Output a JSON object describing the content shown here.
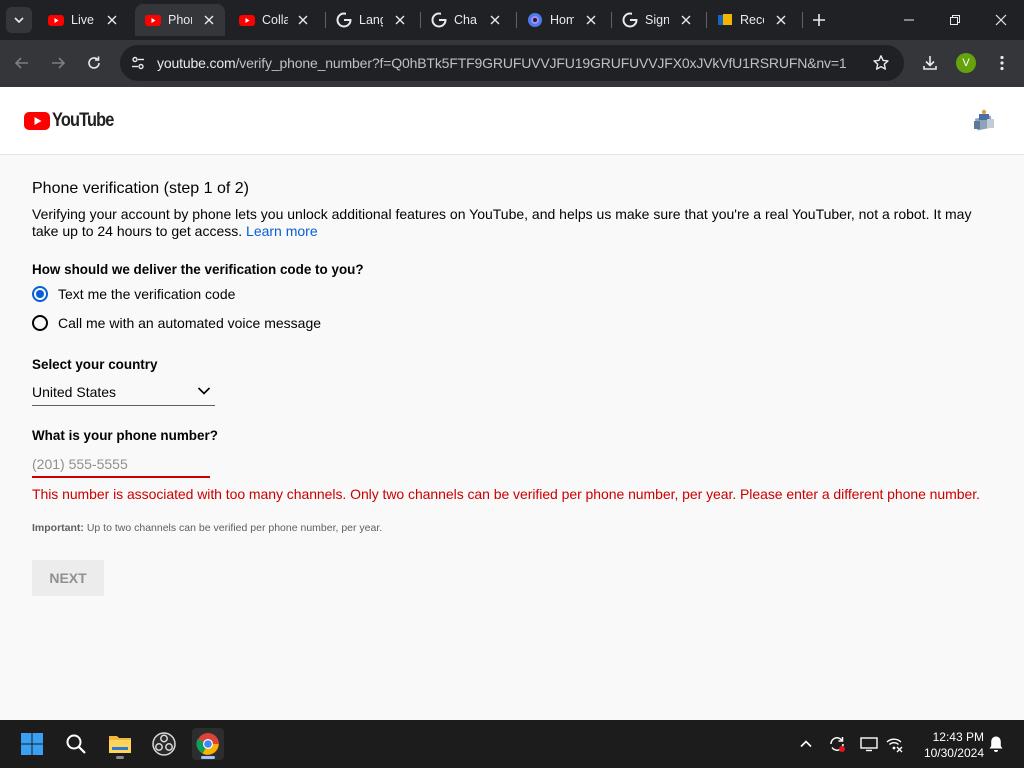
{
  "browser": {
    "tabs": [
      {
        "title": "Live",
        "favicon": "youtube-icon",
        "active": false
      },
      {
        "title": "Phone verification",
        "favicon": "youtube-icon",
        "active": true
      },
      {
        "title": "Collab",
        "favicon": "youtube-icon",
        "active": false
      },
      {
        "title": "Language",
        "favicon": "google-icon",
        "active": false
      },
      {
        "title": "Change",
        "favicon": "google-icon",
        "active": false
      },
      {
        "title": "Home",
        "favicon": "copilot-icon",
        "active": false
      },
      {
        "title": "Sign in",
        "favicon": "google-icon",
        "active": false
      },
      {
        "title": "Recent",
        "favicon": "files-icon",
        "active": false
      }
    ],
    "url_host": "youtube.com",
    "url_path": "/verify_phone_number?f=Q0hBTk5FTF9GRUFUVVJFU19GRUFUVVJFX0xJVkVfU1RSRUFN&nv=1",
    "profile_initial": "V"
  },
  "youtube": {
    "logo_text": "YouTube"
  },
  "verification": {
    "title": "Phone verification (step 1 of 2)",
    "intro": "Verifying your account by phone lets you unlock additional features on YouTube, and helps us make sure that you're a real YouTuber, not a robot. It may take up to 24 hours to get access.",
    "learn_more": "Learn more",
    "delivery_question": "How should we deliver the verification code to you?",
    "delivery_options": [
      {
        "label": "Text me the verification code",
        "checked": true
      },
      {
        "label": "Call me with an automated voice message",
        "checked": false
      }
    ],
    "country_label": "Select your country",
    "country_value": "United States",
    "phone_label": "What is your phone number?",
    "phone_placeholder": "(201) 555-5555",
    "phone_value": "",
    "error": "This number is associated with too many channels. Only two channels can be verified per phone number, per year. Please enter a different phone number.",
    "important_label": "Important:",
    "important_text": "Up to two channels can be verified per phone number, per year.",
    "next_label": "NEXT"
  },
  "taskbar": {
    "apps": [
      "start-icon",
      "search-icon",
      "file-explorer-icon",
      "obs-icon",
      "chrome-icon"
    ],
    "time": "12:43 PM",
    "date": "10/30/2024"
  },
  "colors": {
    "youtube_red": "#ff0000",
    "link_blue": "#065fd4",
    "error_red": "#cc0000",
    "chrome_dark": "#202124",
    "chrome_toolbar": "#35363a"
  }
}
